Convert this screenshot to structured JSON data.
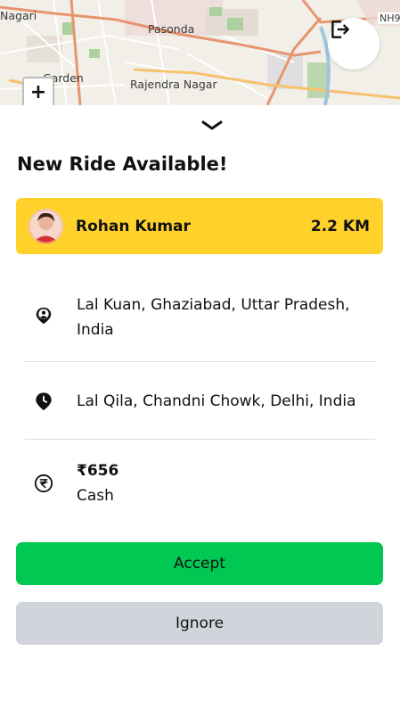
{
  "map": {
    "labels": [
      "Nagari",
      "Pasonda",
      "Garden",
      "Rajendra Nagar",
      "NH9"
    ],
    "zoom_in_label": "+"
  },
  "header": {
    "logout_icon": "logout-icon"
  },
  "ride": {
    "title": "New Ride Available!",
    "rider_name": "Rohan Kumar",
    "distance": "2.2 KM",
    "pickup": "Lal Kuan, Ghaziabad, Uttar Pradesh, India",
    "dropoff": "Lal Qila, Chandni Chowk, Delhi, India",
    "fare": "₹656",
    "payment_method": "Cash"
  },
  "actions": {
    "accept_label": "Accept",
    "ignore_label": "Ignore"
  },
  "colors": {
    "rider_card": "#fed22b",
    "accept": "#00c853",
    "ignore": "#d1d5db"
  }
}
